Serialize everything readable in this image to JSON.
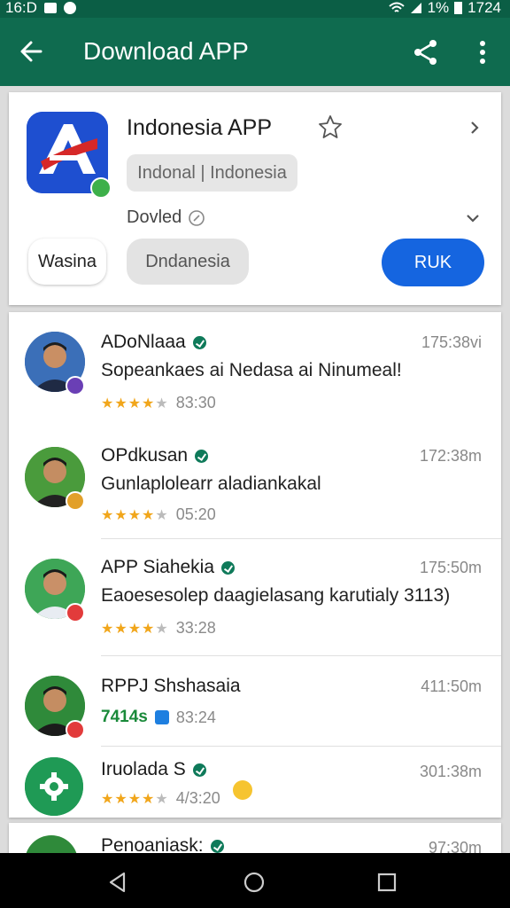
{
  "status_bar": {
    "time": "16:D",
    "battery": "1%",
    "clock": "1724"
  },
  "app_bar": {
    "title": "Download APP"
  },
  "app": {
    "name": "Indonesia APP",
    "tag": "Indonal | Indonesia",
    "developer": "Dovled",
    "btn_left": "Wasina",
    "btn_middle": "Dndanesia",
    "btn_primary": "RUK"
  },
  "reviews": [
    {
      "name": "ADoNlaaa",
      "time": "175:38vi",
      "text": "Sopeankaes ai Nedasa ai Ninumeal!",
      "rating": 4,
      "meta": "83:30"
    },
    {
      "name": "OPdkusan",
      "time": "172:38m",
      "text": "Gunlaplolearr aladiankakal",
      "rating": 4,
      "meta": "05:20"
    },
    {
      "name": "APP Siahekia",
      "time": "175:50m",
      "text": "Eaoesesolep daagielasang karutialy 3113)",
      "rating": 4,
      "meta": "33:28"
    },
    {
      "name": "RPPJ Shshasaia",
      "time": "411:50m",
      "text": "",
      "rating_text": "7414s",
      "meta": "83:24"
    },
    {
      "name": "Iruolada S",
      "time": "301:38m",
      "text": "",
      "rating": 4,
      "meta": "4/3:20"
    },
    {
      "name": "Penoaniask:",
      "time": "97:30m"
    }
  ],
  "colors": {
    "appbar": "#0f6b4f",
    "statusbar": "#0b5e45",
    "primary_button": "#1565e0",
    "star": "#f1a61b"
  }
}
